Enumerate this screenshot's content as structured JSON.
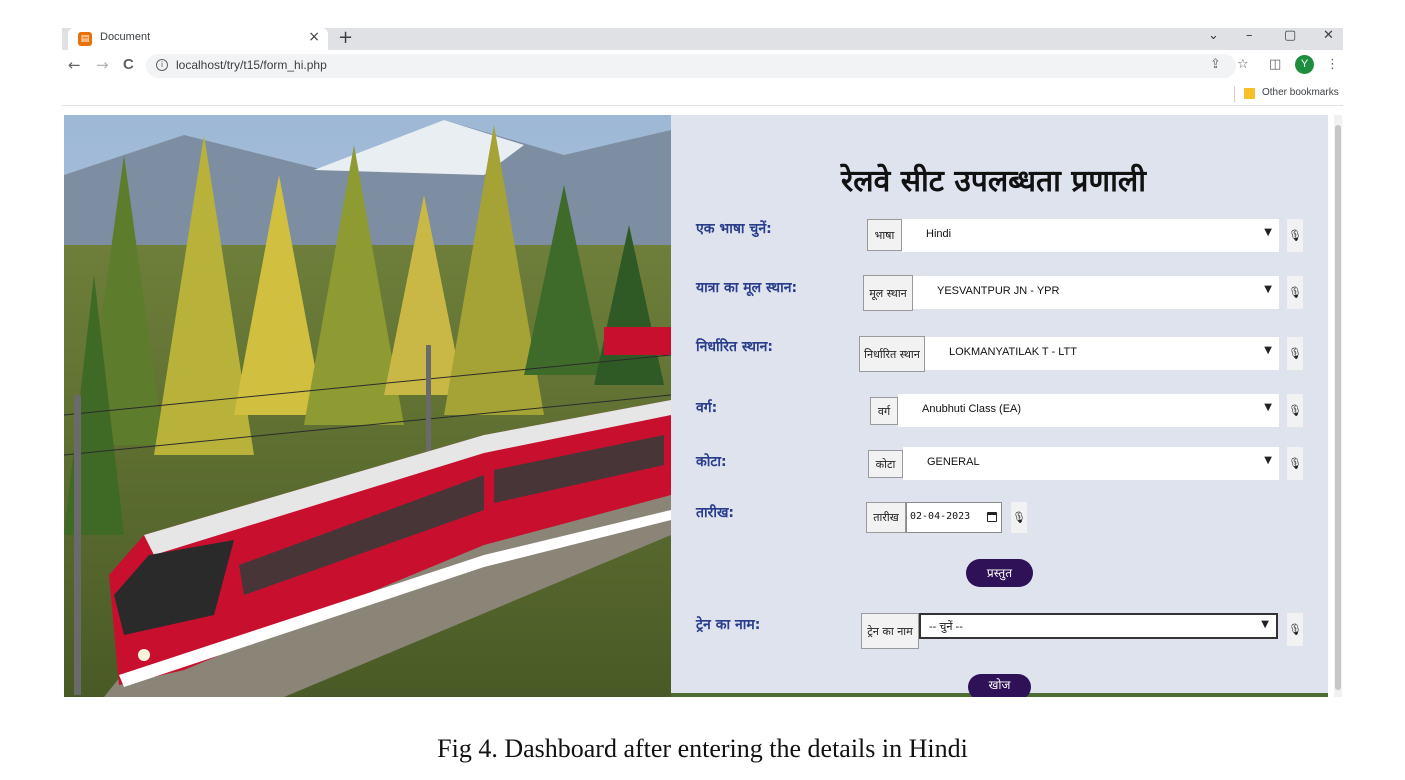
{
  "browser": {
    "tab_title": "Document",
    "tab_close": "×",
    "new_tab": "+",
    "window_controls": [
      "⌄",
      "–",
      "▢",
      "✕"
    ],
    "nav": {
      "back": "←",
      "forward": "→",
      "reload": "C"
    },
    "url": "localhost/try/t15/form_hi.php",
    "toolbar_icons": {
      "share": "⇪",
      "star": "☆",
      "sidepanel": "◫",
      "menu": "⋮"
    },
    "profile_initial": "Y",
    "bookmarks_label": "Other bookmarks"
  },
  "form": {
    "title": "रेलवे सीट उपलब्धता प्रणाली",
    "language": {
      "label": "एक भाषा चुनें:",
      "tag": "भाषा",
      "value": "Hindi"
    },
    "origin": {
      "label": "यात्रा का मूल स्थान:",
      "tag": "मूल स्थान",
      "value": "YESVANTPUR JN - YPR"
    },
    "destination": {
      "label": "निर्धारित स्थान:",
      "tag": "निर्धारित स्थान",
      "value": "LOKMANYATILAK T - LTT"
    },
    "class": {
      "label": "वर्ग:",
      "tag": "वर्ग",
      "value": "Anubhuti Class (EA)"
    },
    "quota": {
      "label": "कोटा:",
      "tag": "कोटा",
      "value": "GENERAL"
    },
    "date": {
      "label": "तारीख:",
      "tag": "तारीख",
      "value": "02-04-2023"
    },
    "submit_label": "प्रस्तुत",
    "train": {
      "label": "ट्रेन का नाम:",
      "tag": "ट्रेन का नाम",
      "value": "-- चुनें --"
    },
    "search_label": "खोज"
  },
  "caption": "Fig 4. Dashboard after entering the details in Hindi",
  "colors": {
    "panel_bg": "#dfe3ee",
    "label_blue": "#283d8c",
    "button_purple": "#2e1156",
    "train_red": "#c8102e"
  },
  "icons": [
    "document-favicon",
    "info-icon",
    "mic-icon",
    "calendar-icon",
    "chevron-down-icon",
    "folder-icon"
  ]
}
